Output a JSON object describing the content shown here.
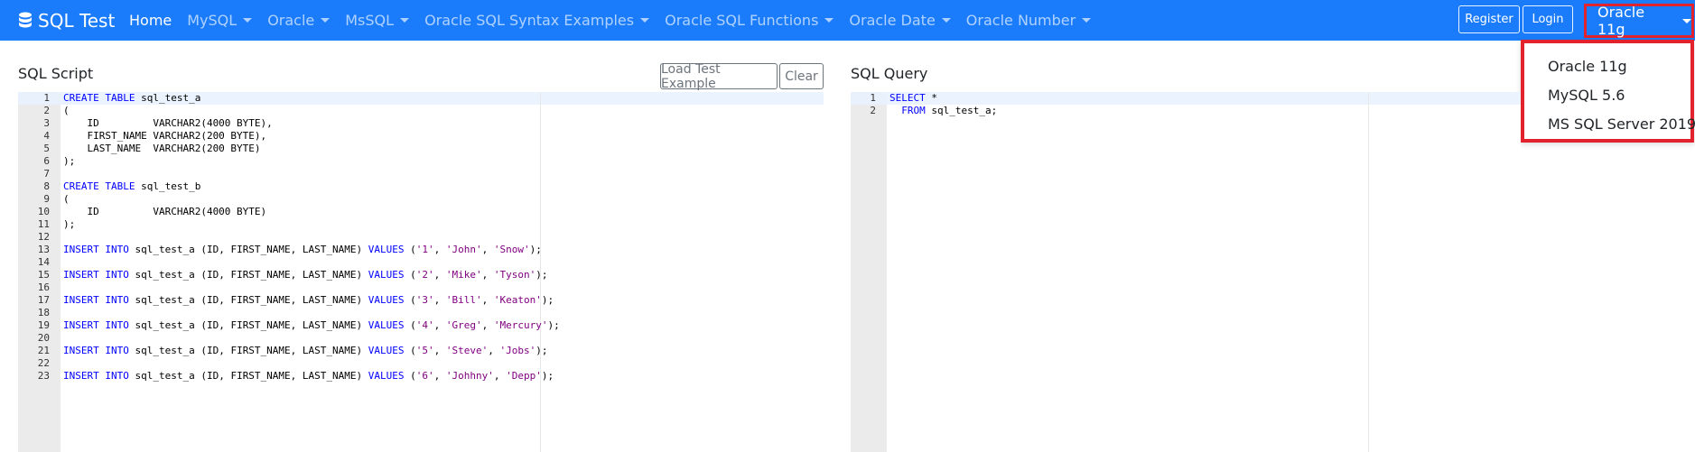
{
  "navbar": {
    "brand": "SQL Test",
    "brand_icon": "database-icon",
    "links": [
      {
        "label": "Home",
        "active": true,
        "dropdown": false
      },
      {
        "label": "MySQL",
        "active": false,
        "dropdown": true
      },
      {
        "label": "Oracle",
        "active": false,
        "dropdown": true
      },
      {
        "label": "MsSQL",
        "active": false,
        "dropdown": true
      },
      {
        "label": "Oracle SQL Syntax Examples",
        "active": false,
        "dropdown": true
      },
      {
        "label": "Oracle SQL Functions",
        "active": false,
        "dropdown": true
      },
      {
        "label": "Oracle Date",
        "active": false,
        "dropdown": true
      },
      {
        "label": "Oracle Number",
        "active": false,
        "dropdown": true
      }
    ],
    "register_label": "Register",
    "login_label": "Login",
    "db_selector": "Oracle 11g"
  },
  "db_dropdown": {
    "options": [
      "Oracle 11g",
      "MySQL 5.6",
      "MS SQL Server 2019"
    ]
  },
  "script_panel": {
    "title": "SQL Script",
    "load_button": "Load Test Example",
    "clear_button": "Clear",
    "lines": [
      [
        [
          "kw",
          "CREATE TABLE"
        ],
        [
          "t",
          " sql_test_a"
        ]
      ],
      [
        [
          "t",
          "("
        ]
      ],
      [
        [
          "t",
          "    ID         VARCHAR2(4000 BYTE),"
        ]
      ],
      [
        [
          "t",
          "    FIRST_NAME VARCHAR2(200 BYTE),"
        ]
      ],
      [
        [
          "t",
          "    LAST_NAME  VARCHAR2(200 BYTE)"
        ]
      ],
      [
        [
          "t",
          ");"
        ]
      ],
      [],
      [
        [
          "kw",
          "CREATE TABLE"
        ],
        [
          "t",
          " sql_test_b"
        ]
      ],
      [
        [
          "t",
          "("
        ]
      ],
      [
        [
          "t",
          "    ID         VARCHAR2(4000 BYTE)"
        ]
      ],
      [
        [
          "t",
          ");"
        ]
      ],
      [],
      [
        [
          "kw",
          "INSERT INTO"
        ],
        [
          "t",
          " sql_test_a (ID, FIRST_NAME, LAST_NAME) "
        ],
        [
          "kw",
          "VALUES"
        ],
        [
          "t",
          " ("
        ],
        [
          "str",
          "'1'"
        ],
        [
          "t",
          ", "
        ],
        [
          "str",
          "'John'"
        ],
        [
          "t",
          ", "
        ],
        [
          "str",
          "'Snow'"
        ],
        [
          "t",
          ");"
        ]
      ],
      [],
      [
        [
          "kw",
          "INSERT INTO"
        ],
        [
          "t",
          " sql_test_a (ID, FIRST_NAME, LAST_NAME) "
        ],
        [
          "kw",
          "VALUES"
        ],
        [
          "t",
          " ("
        ],
        [
          "str",
          "'2'"
        ],
        [
          "t",
          ", "
        ],
        [
          "str",
          "'Mike'"
        ],
        [
          "t",
          ", "
        ],
        [
          "str",
          "'Tyson'"
        ],
        [
          "t",
          ");"
        ]
      ],
      [],
      [
        [
          "kw",
          "INSERT INTO"
        ],
        [
          "t",
          " sql_test_a (ID, FIRST_NAME, LAST_NAME) "
        ],
        [
          "kw",
          "VALUES"
        ],
        [
          "t",
          " ("
        ],
        [
          "str",
          "'3'"
        ],
        [
          "t",
          ", "
        ],
        [
          "str",
          "'Bill'"
        ],
        [
          "t",
          ", "
        ],
        [
          "str",
          "'Keaton'"
        ],
        [
          "t",
          ");"
        ]
      ],
      [],
      [
        [
          "kw",
          "INSERT INTO"
        ],
        [
          "t",
          " sql_test_a (ID, FIRST_NAME, LAST_NAME) "
        ],
        [
          "kw",
          "VALUES"
        ],
        [
          "t",
          " ("
        ],
        [
          "str",
          "'4'"
        ],
        [
          "t",
          ", "
        ],
        [
          "str",
          "'Greg'"
        ],
        [
          "t",
          ", "
        ],
        [
          "str",
          "'Mercury'"
        ],
        [
          "t",
          ");"
        ]
      ],
      [],
      [
        [
          "kw",
          "INSERT INTO"
        ],
        [
          "t",
          " sql_test_a (ID, FIRST_NAME, LAST_NAME) "
        ],
        [
          "kw",
          "VALUES"
        ],
        [
          "t",
          " ("
        ],
        [
          "str",
          "'5'"
        ],
        [
          "t",
          ", "
        ],
        [
          "str",
          "'Steve'"
        ],
        [
          "t",
          ", "
        ],
        [
          "str",
          "'Jobs'"
        ],
        [
          "t",
          ");"
        ]
      ],
      [],
      [
        [
          "kw",
          "INSERT INTO"
        ],
        [
          "t",
          " sql_test_a (ID, FIRST_NAME, LAST_NAME) "
        ],
        [
          "kw",
          "VALUES"
        ],
        [
          "t",
          " ("
        ],
        [
          "str",
          "'6'"
        ],
        [
          "t",
          ", "
        ],
        [
          "str",
          "'Johhny'"
        ],
        [
          "t",
          ", "
        ],
        [
          "str",
          "'Depp'"
        ],
        [
          "t",
          ");"
        ]
      ]
    ]
  },
  "query_panel": {
    "title": "SQL Query",
    "lines": [
      [
        [
          "kw",
          "SELECT"
        ],
        [
          "t",
          " *"
        ]
      ],
      [
        [
          "t",
          "  "
        ],
        [
          "kw",
          "FROM"
        ],
        [
          "t",
          " sql_test_a;"
        ]
      ]
    ]
  }
}
